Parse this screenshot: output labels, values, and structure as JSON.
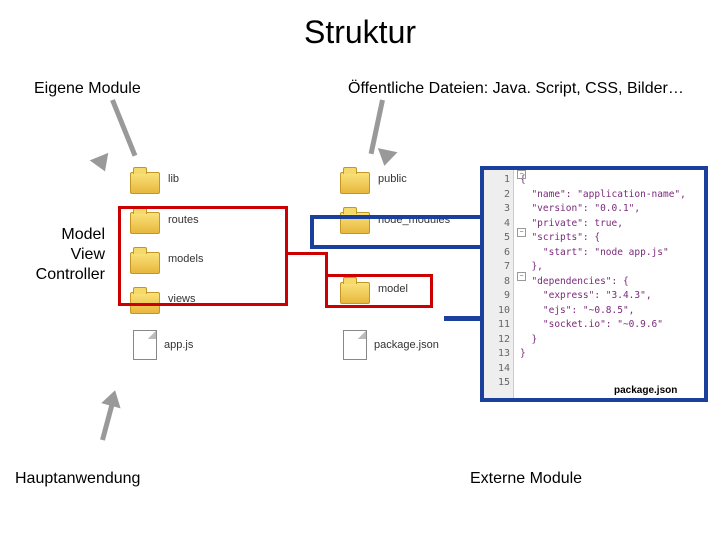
{
  "title": "Struktur",
  "labels": {
    "eigene": "Eigene Module",
    "oeffentliche": "Öffentliche Dateien: Java. Script, CSS, Bilder…",
    "mvc": "Model\nView\nController",
    "haupt": "Hauptanwendung",
    "externe": "Externe Module"
  },
  "leftFolders": {
    "f1": "lib",
    "f2": "routes",
    "f3": "models",
    "f4": "views",
    "file": "app.js"
  },
  "rightFolders": {
    "f1": "public",
    "f2": "node_modules",
    "f3": "model",
    "file": "package.json"
  },
  "code": {
    "lines": [
      "1",
      "2",
      "3",
      "4",
      "5",
      "6",
      "7",
      "8",
      "9",
      "10",
      "11",
      "12",
      "13",
      "14",
      "15"
    ],
    "text": [
      "{",
      "  \"name\": \"application-name\",",
      "  \"version\": \"0.0.1\",",
      "  \"private\": true,",
      "  \"scripts\": {",
      "    \"start\": \"node app.js\"",
      "  },",
      "  \"dependencies\": {",
      "    \"express\": \"3.4.3\",",
      "    \"ejs\": \"~0.8.5\",",
      "    \"socket.io\": \"~0.9.6\"",
      "  }",
      "}",
      "",
      ""
    ],
    "caption": "package.json"
  }
}
